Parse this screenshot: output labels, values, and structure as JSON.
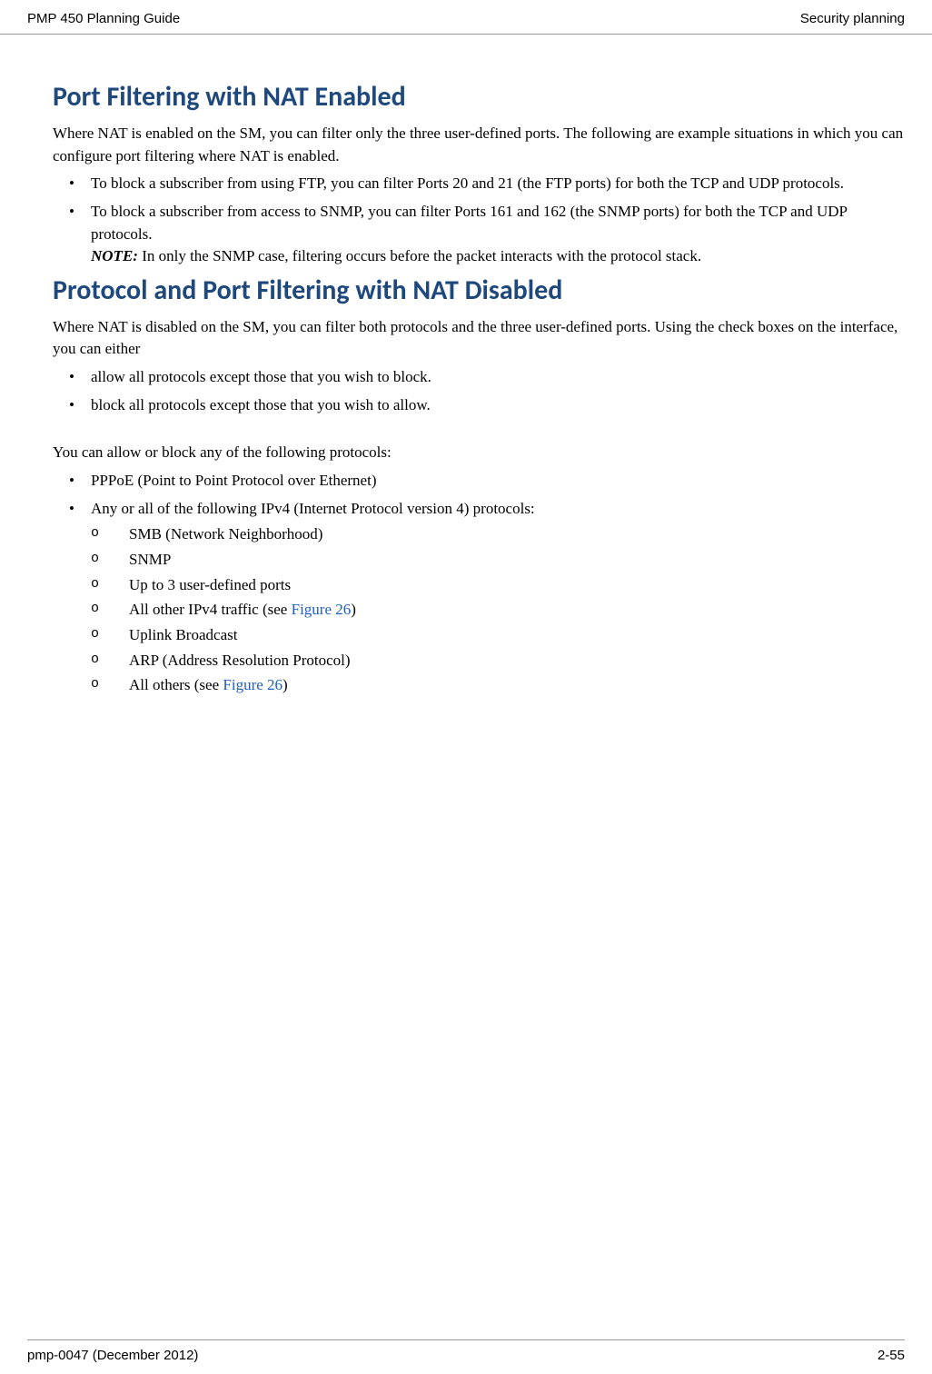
{
  "header": {
    "left": "PMP 450 Planning Guide",
    "right": "Security planning"
  },
  "footer": {
    "left": "pmp-0047 (December 2012)",
    "right": "2-55"
  },
  "section1": {
    "title": "Port Filtering with NAT Enabled",
    "intro": "Where NAT is enabled on the SM, you can filter only the three user-defined ports. The following are example situations in which you can configure port filtering where NAT is enabled.",
    "bullet1": "To block a subscriber from using FTP, you can filter Ports 20 and 21 (the FTP ports) for both the TCP and UDP protocols.",
    "bullet2": "To block a subscriber from access to SNMP, you can filter Ports 161 and 162 (the SNMP ports) for both the TCP and UDP protocols.",
    "note_label": "NOTE:",
    "note_text": " In only the SNMP case, filtering occurs before the packet interacts with the protocol stack."
  },
  "section2": {
    "title": "Protocol and Port Filtering with NAT Disabled",
    "intro": "Where NAT is disabled on the SM, you can filter both protocols and the three user-defined ports. Using the check boxes on the interface, you can either",
    "bullet1": "allow all protocols except those that you wish to block.",
    "bullet2": "block all protocols except those that you wish to allow.",
    "followup": "You can allow or block any of the following protocols:",
    "proto1": "PPPoE (Point to Point Protocol over Ethernet)",
    "proto2": "Any or all of the following IPv4 (Internet Protocol version 4) protocols:",
    "sub1": "SMB (Network Neighborhood)",
    "sub2": "SNMP",
    "sub3": "Up to 3 user-defined ports",
    "sub4_pre": "All other IPv4 traffic (see ",
    "sub4_link": "Figure 26",
    "sub4_post": ")",
    "sub5": "Uplink Broadcast",
    "sub6": "ARP (Address Resolution Protocol)",
    "sub7_pre": "All others (see ",
    "sub7_link": "Figure 26",
    "sub7_post": ")"
  }
}
